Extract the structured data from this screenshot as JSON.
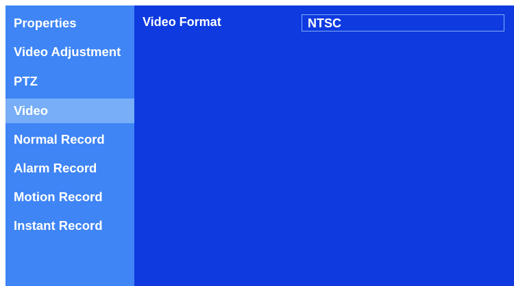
{
  "sidebar": {
    "items": [
      {
        "label": "Properties",
        "selected": false
      },
      {
        "label": "Video Adjustment",
        "selected": false
      },
      {
        "label": "PTZ",
        "selected": false
      },
      {
        "label": "Video",
        "selected": true
      },
      {
        "label": "Normal Record",
        "selected": false
      },
      {
        "label": "Alarm Record",
        "selected": false
      },
      {
        "label": "Motion Record",
        "selected": false
      },
      {
        "label": "Instant Record",
        "selected": false
      }
    ]
  },
  "main": {
    "video_format": {
      "label": "Video Format",
      "value": "NTSC"
    }
  },
  "colors": {
    "sidebar_background": "#3f85f5",
    "sidebar_selected": "#77aef7",
    "main_background": "#0e3ae0",
    "field_border": "#86aef5",
    "text": "#ffffff"
  }
}
